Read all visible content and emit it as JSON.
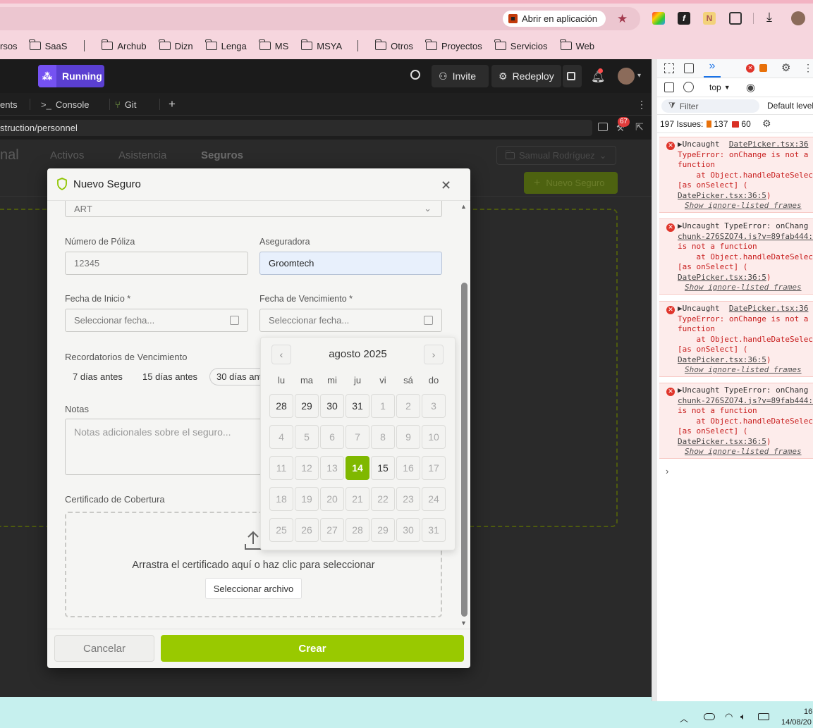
{
  "browser": {
    "open_in_app": "Abrir en aplicación",
    "bookmarks": [
      "rsos",
      "SaaS",
      "Archub",
      "Dizn",
      "Lenga",
      "MS",
      "MSYA",
      "Otros",
      "Proyectos",
      "Servicios",
      "Web"
    ]
  },
  "app": {
    "status": "Running",
    "invite": "Invite",
    "redeploy": "Redeploy",
    "tabs": [
      "ents",
      "Console",
      "Git"
    ],
    "url": "struction/personnel",
    "badge_count": "67"
  },
  "page": {
    "title_partial": "nal",
    "tabs": [
      "Activos",
      "Asistencia",
      "Seguros"
    ],
    "user_select": "Samual Rodríguez",
    "new_button": "Nuevo Seguro"
  },
  "modal": {
    "title": "Nuevo Seguro",
    "type_value": "ART",
    "policy_label": "Número de Póliza",
    "policy_value": "12345",
    "insurer_label": "Aseguradora",
    "insurer_value": "Groomtech",
    "start_label": "Fecha de Inicio *",
    "start_placeholder": "Seleccionar fecha...",
    "end_label": "Fecha de Vencimiento *",
    "end_placeholder": "Seleccionar fecha...",
    "reminders_label": "Recordatorios de Vencimiento",
    "reminders": [
      "7 días antes",
      "15 días antes",
      "30 días ant"
    ],
    "notes_label": "Notas",
    "notes_placeholder": "Notas adicionales sobre el seguro...",
    "cert_label": "Certificado de Cobertura",
    "cert_drop_text": "Arrastra el certificado aquí o haz clic para seleccionar",
    "cert_button": "Seleccionar archivo",
    "cancel": "Cancelar",
    "create": "Crear"
  },
  "calendar": {
    "month": "agosto 2025",
    "weekdays": [
      "lu",
      "ma",
      "mi",
      "ju",
      "vi",
      "sá",
      "do"
    ],
    "days": [
      [
        "28",
        "29",
        "30",
        "31",
        "1",
        "2",
        "3"
      ],
      [
        "4",
        "5",
        "6",
        "7",
        "8",
        "9",
        "10"
      ],
      [
        "11",
        "12",
        "13",
        "14",
        "15",
        "16",
        "17"
      ],
      [
        "18",
        "19",
        "20",
        "21",
        "22",
        "23",
        "24"
      ],
      [
        "25",
        "26",
        "27",
        "28",
        "29",
        "30",
        "31"
      ]
    ],
    "selected": "14",
    "enabled": [
      "28",
      "29",
      "30",
      "31",
      "14",
      "15"
    ]
  },
  "devtools": {
    "context": "top",
    "filter": "Filter",
    "levels": "Default level",
    "issues_label": "197 Issues:",
    "warn_count": "137",
    "info_count": "60",
    "errors": [
      {
        "lines": "▶Uncaught  ",
        "link1": "DatePicker.tsx:36",
        "body": "TypeError: onChange is not a\nfunction\n    at Object.handleDateSelec\n[as onSelect] (",
        "link2": "DatePicker.tsx:36:5",
        "tail": ")",
        "show": "Show ignore-listed frames"
      },
      {
        "lines": "▶Uncaught TypeError: onChang\n",
        "link1": "chunk-276SZO74.js?v=89fab444:",
        "body": "\nis not a function\n    at Object.handleDateSelec\n[as onSelect] (",
        "link2": "DatePicker.tsx:36:5",
        "tail": ")",
        "show": "Show ignore-listed frames"
      },
      {
        "lines": "▶Uncaught  ",
        "link1": "DatePicker.tsx:36",
        "body": "TypeError: onChange is not a\nfunction\n    at Object.handleDateSelec\n[as onSelect] (",
        "link2": "DatePicker.tsx:36:5",
        "tail": ")",
        "show": "Show ignore-listed frames"
      },
      {
        "lines": "▶Uncaught TypeError: onChang\n",
        "link1": "chunk-276SZO74.js?v=89fab444:",
        "body": "\nis not a function\n    at Object.handleDateSelec\n[as onSelect] (",
        "link2": "DatePicker.tsx:36:5",
        "tail": ")",
        "show": "Show ignore-listed frames"
      }
    ]
  },
  "taskbar": {
    "time": "16",
    "date": "14/08/20"
  },
  "colors": {
    "accent": "#99c900",
    "selected_day": "#7fb800",
    "running": "#5a3fd1"
  }
}
